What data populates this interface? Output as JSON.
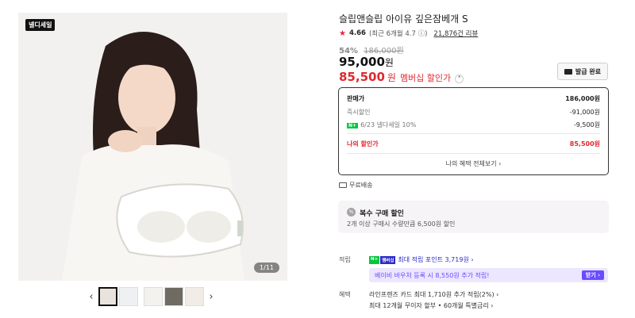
{
  "gallery": {
    "brand_badge": "넬디세일",
    "image_counter": "1/11",
    "prev_arrow": "‹",
    "next_arrow": "›",
    "thumbnail_count": 5
  },
  "product": {
    "title": "슬립앤슬립 아이유 깊은잠베개 S",
    "rating": {
      "score": "4.66",
      "recent": "(최근 6개월 4.7",
      "recent_info": "ⓘ)",
      "reviews": "21,876건 리뷰"
    },
    "discount_rate": "54%",
    "original_price": "186,000원",
    "sale_price": "95,000",
    "sale_price_unit": "원",
    "member_price": "85,500",
    "member_price_unit": "원",
    "member_label": "멤버십 할인가",
    "coupon_button": "발급 완료"
  },
  "price_detail": {
    "rows": [
      {
        "label": "판매가",
        "value": "186,000원"
      },
      {
        "label": "즉시할인",
        "value": "-91,000원"
      },
      {
        "label": "6/23 넬다세일 10%",
        "value": "-9,500원",
        "badge": "N+"
      }
    ],
    "my_discount": {
      "label": "나의 할인가",
      "value": "85,500원"
    },
    "benefits_link": "나의 혜택 전체보기 ›"
  },
  "shipping": {
    "label": "무료배송"
  },
  "multi_buy": {
    "icon": "%",
    "title": "복수 구매 할인",
    "desc": "2개 이상 구매시 수량만큼 6,500원 할인"
  },
  "points": {
    "label": "적립",
    "badge_n": "N+",
    "badge_p": "멤버십",
    "text": "최대 적립 포인트 3,719원 ›",
    "voucher_text": "베이비 바우처 등록 시 8,550원 추가 적립!",
    "voucher_button": "받기 ›"
  },
  "benefits": {
    "label": "혜택",
    "lines": [
      "라인프렌즈 카드 최대 1,710원 추가 적립(2%) ›",
      "최대 12개월 무이자 할부 • 60개월 특별금리 ›"
    ]
  },
  "colors": {
    "accent_red": "#e0282e",
    "point_blue": "#2a2ac6",
    "voucher_purple": "#6a4cff",
    "naver_green": "#00c73c"
  }
}
